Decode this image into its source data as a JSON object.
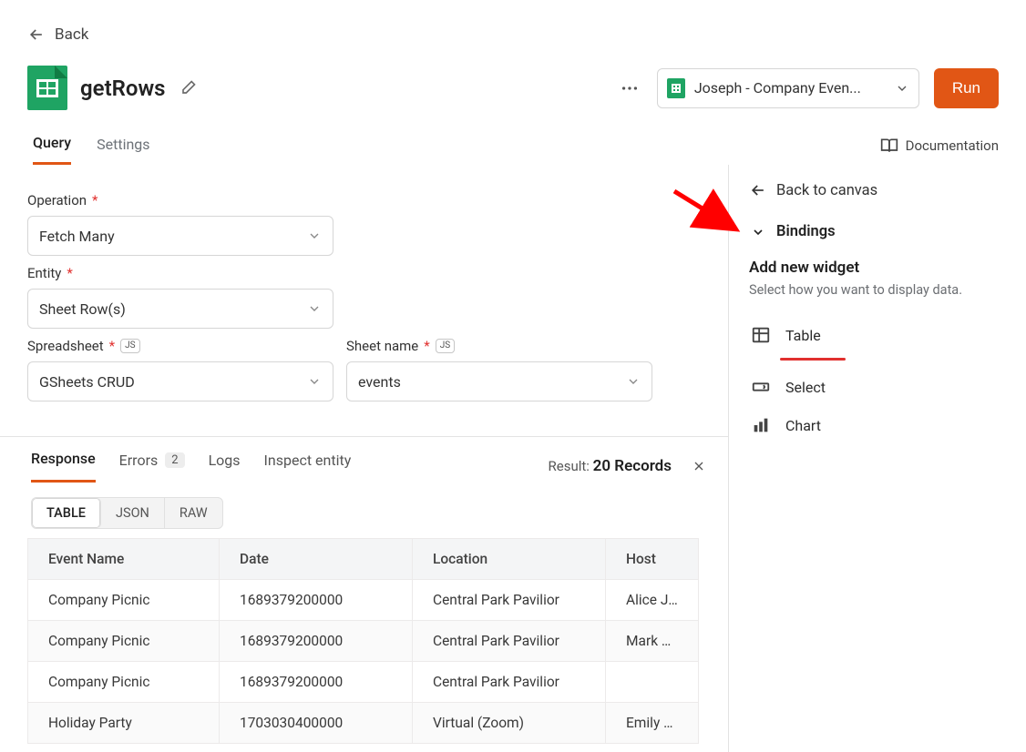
{
  "back_label": "Back",
  "query_name": "getRows",
  "datasource_selected": "Joseph - Company Even...",
  "run_label": "Run",
  "tabs": {
    "query": "Query",
    "settings": "Settings"
  },
  "documentation_label": "Documentation",
  "form": {
    "operation_label": "Operation",
    "operation_value": "Fetch Many",
    "entity_label": "Entity",
    "entity_value": "Sheet Row(s)",
    "spreadsheet_label": "Spreadsheet",
    "spreadsheet_value": "GSheets CRUD",
    "sheetname_label": "Sheet name",
    "sheetname_value": "events",
    "js_badge": "JS"
  },
  "response": {
    "tabs": {
      "response": "Response",
      "errors": "Errors",
      "errors_count": "2",
      "logs": "Logs",
      "inspect": "Inspect entity"
    },
    "result_prefix": "Result:",
    "result_value": "20 Records",
    "views": {
      "table": "TABLE",
      "json": "JSON",
      "raw": "RAW"
    },
    "columns": [
      "Event Name",
      "Date",
      "Location",
      "Host"
    ],
    "rows": [
      [
        "Company Picnic",
        "1689379200000",
        "Central Park Pavilior",
        "Alice Joh"
      ],
      [
        "Company Picnic",
        "1689379200000",
        "Central Park Pavilior",
        "Mark Wil"
      ],
      [
        "Company Picnic",
        "1689379200000",
        "Central Park Pavilior",
        ""
      ],
      [
        "Holiday Party",
        "1703030400000",
        "Virtual (Zoom)",
        "Emily Da"
      ]
    ]
  },
  "right": {
    "back_to_canvas": "Back to canvas",
    "bindings": "Bindings",
    "add_widget_title": "Add new widget",
    "add_widget_sub": "Select how you want to display data.",
    "options": {
      "table": "Table",
      "select": "Select",
      "chart": "Chart"
    }
  }
}
